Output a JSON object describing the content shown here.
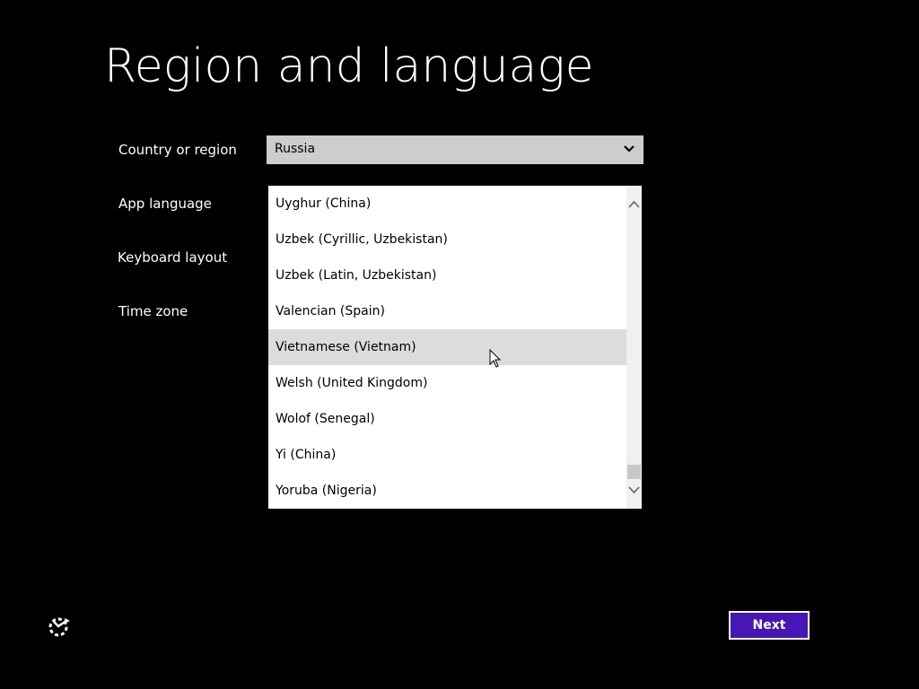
{
  "page": {
    "title": "Region and language"
  },
  "form": {
    "country_label": "Country or region",
    "country_value": "Russia",
    "app_language_label": "App language",
    "keyboard_layout_label": "Keyboard layout",
    "time_zone_label": "Time zone"
  },
  "dropdown": {
    "items": [
      {
        "label": "Uyghur (China)"
      },
      {
        "label": "Uzbek (Cyrillic, Uzbekistan)"
      },
      {
        "label": "Uzbek (Latin, Uzbekistan)"
      },
      {
        "label": "Valencian (Spain)"
      },
      {
        "label": "Vietnamese (Vietnam)",
        "hovered": true
      },
      {
        "label": "Welsh (United Kingdom)"
      },
      {
        "label": "Wolof (Senegal)"
      },
      {
        "label": "Yi (China)"
      },
      {
        "label": "Yoruba (Nigeria)"
      }
    ]
  },
  "footer": {
    "next_label": "Next",
    "ease_of_access_icon": "ease-of-access-icon"
  },
  "colors": {
    "background": "#000000",
    "accent": "#4617b4",
    "select_bg": "#cdcdcd",
    "hover_bg": "#dcdcdc"
  }
}
